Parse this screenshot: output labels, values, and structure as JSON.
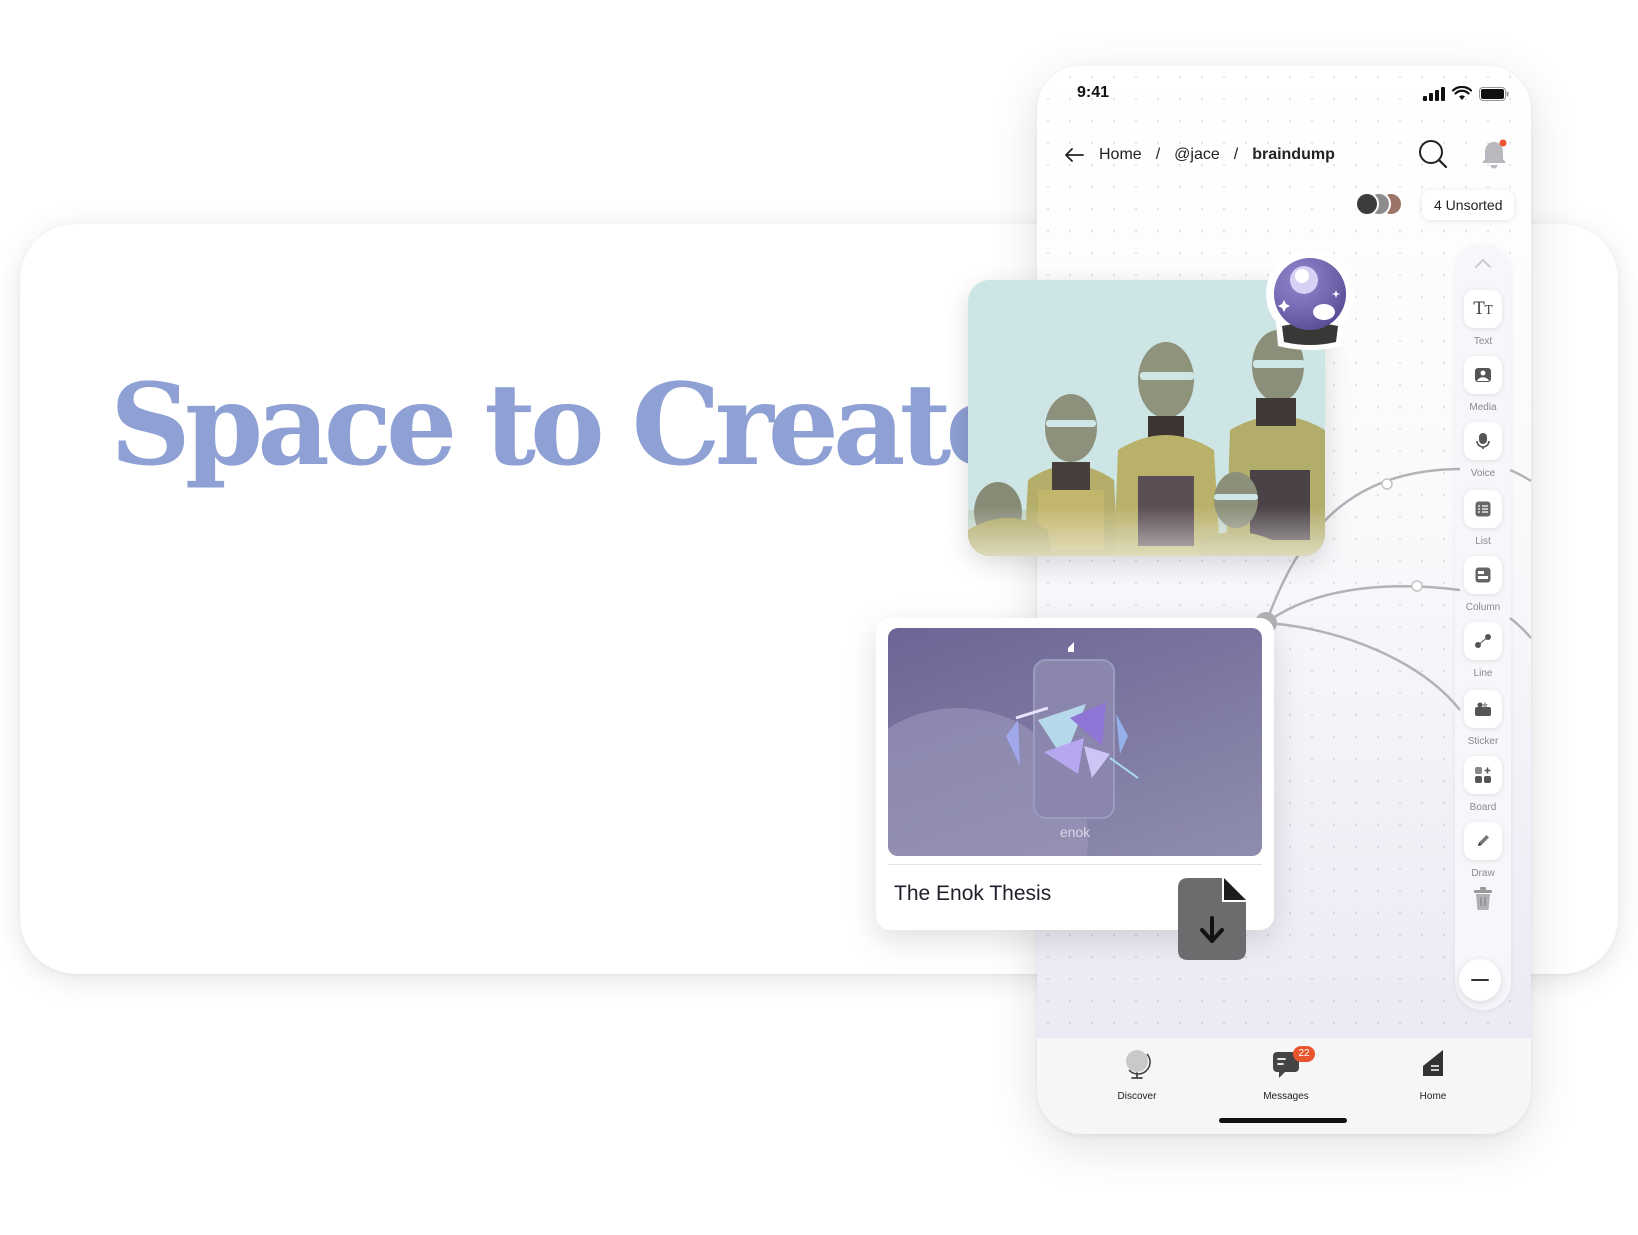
{
  "hero": {
    "title": "Space to Create"
  },
  "phone": {
    "status_bar": {
      "time": "9:41"
    },
    "breadcrumb": {
      "home": "Home",
      "user": "@jace",
      "current": "braindump",
      "separator": "/"
    },
    "unsorted_chip": "4 Unsorted",
    "toolbar": {
      "items": [
        {
          "label": "Text",
          "icon": "text-icon"
        },
        {
          "label": "Media",
          "icon": "media-icon"
        },
        {
          "label": "Voice",
          "icon": "microphone-icon"
        },
        {
          "label": "List",
          "icon": "checklist-icon"
        },
        {
          "label": "Column",
          "icon": "column-icon"
        },
        {
          "label": "Line",
          "icon": "line-icon"
        },
        {
          "label": "Sticker",
          "icon": "sticker-icon"
        },
        {
          "label": "Board",
          "icon": "board-icon"
        },
        {
          "label": "Draw",
          "icon": "pencil-icon"
        }
      ]
    },
    "tabbar": {
      "discover": "Discover",
      "messages": "Messages",
      "messages_badge": "22",
      "home": "Home"
    }
  },
  "canvas": {
    "doc_card": {
      "title": "The Enok Thesis",
      "brand_text": "enok"
    }
  },
  "colors": {
    "hero_title": "#8ea0d4",
    "badge": "#e8552f",
    "doc_bg": "#6c6596"
  }
}
